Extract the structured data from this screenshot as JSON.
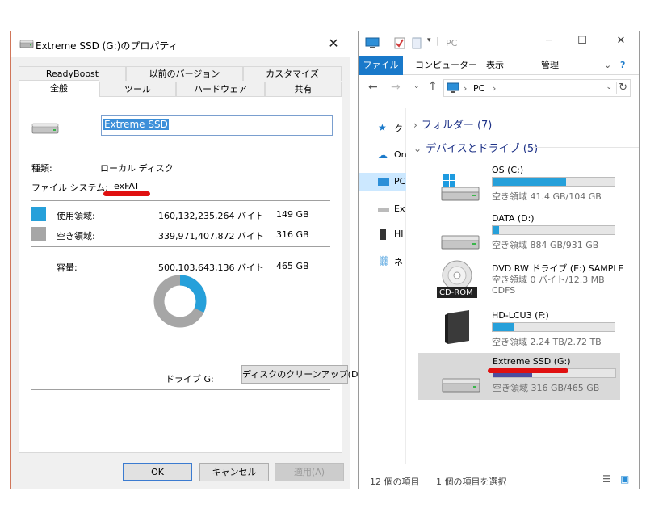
{
  "dialog": {
    "title": "Extreme SSD (G:)のプロパティ",
    "tabs_row1": [
      "ReadyBoost",
      "以前のバージョン",
      "カスタマイズ"
    ],
    "tabs_row2": [
      "全般",
      "ツール",
      "ハードウェア",
      "共有"
    ],
    "active_tab": "全般",
    "volume_name": "Extreme SSD",
    "type_label": "種類:",
    "type_value": "ローカル ディスク",
    "fs_label": "ファイル システム:",
    "fs_value": "exFAT",
    "used_label": "使用領域:",
    "used_bytes": "160,132,235,264 バイト",
    "used_gb": "149 GB",
    "free_label": "空き領域:",
    "free_bytes": "339,971,407,872 バイト",
    "free_gb": "316 GB",
    "capacity_label": "容量:",
    "capacity_bytes": "500,103,643,136 バイト",
    "capacity_gb": "465 GB",
    "drive_label": "ドライブ G:",
    "cleanup_button": "ディスクのクリーンアップ(D)",
    "ok_button": "OK",
    "cancel_button": "キャンセル",
    "apply_button": "適用(A)",
    "used_fraction": 0.32,
    "colors": {
      "used": "#26a0da",
      "free": "#a6a6a6",
      "highlight": "#e01010"
    }
  },
  "explorer": {
    "title": "PC",
    "ribbon_tabs": [
      "ファイル",
      "コンピューター",
      "表示",
      "管理"
    ],
    "address": "PC",
    "nav_items": [
      {
        "label": "ク",
        "icon": "star-icon"
      },
      {
        "label": "On",
        "icon": "cloud-icon"
      },
      {
        "label": "PC",
        "icon": "pc-icon"
      },
      {
        "label": "Ex",
        "icon": "drive-icon"
      },
      {
        "label": "HI",
        "icon": "external-drive-icon"
      },
      {
        "label": "ネ",
        "icon": "network-icon"
      }
    ],
    "folders_group": "フォルダー (7)",
    "drives_group": "デバイスとドライブ (5)",
    "drives": [
      {
        "name": "OS (C:)",
        "detail": "空き領域 41.4 GB/104 GB",
        "used_fraction": 0.6,
        "icon": "windows-drive-icon"
      },
      {
        "name": "DATA (D:)",
        "detail": "空き領域 884 GB/931 GB",
        "used_fraction": 0.05,
        "icon": "hdd-icon"
      },
      {
        "name": "DVD RW ドライブ (E:) SAMPLE",
        "detail": "空き領域 0 バイト/12.3 MB",
        "detail2": "CDFS",
        "icon": "cd-rom-icon",
        "badge": "CD-ROM"
      },
      {
        "name": "HD-LCU3 (F:)",
        "detail": "空き領域 2.24 TB/2.72 TB",
        "used_fraction": 0.18,
        "icon": "external-hdd-icon"
      },
      {
        "name": "Extreme SSD (G:)",
        "detail": "空き領域 316 GB/465 GB",
        "used_fraction": 0.32,
        "icon": "hdd-icon"
      }
    ],
    "status_count": "12 個の項目",
    "status_selected": "1 個の項目を選択"
  }
}
